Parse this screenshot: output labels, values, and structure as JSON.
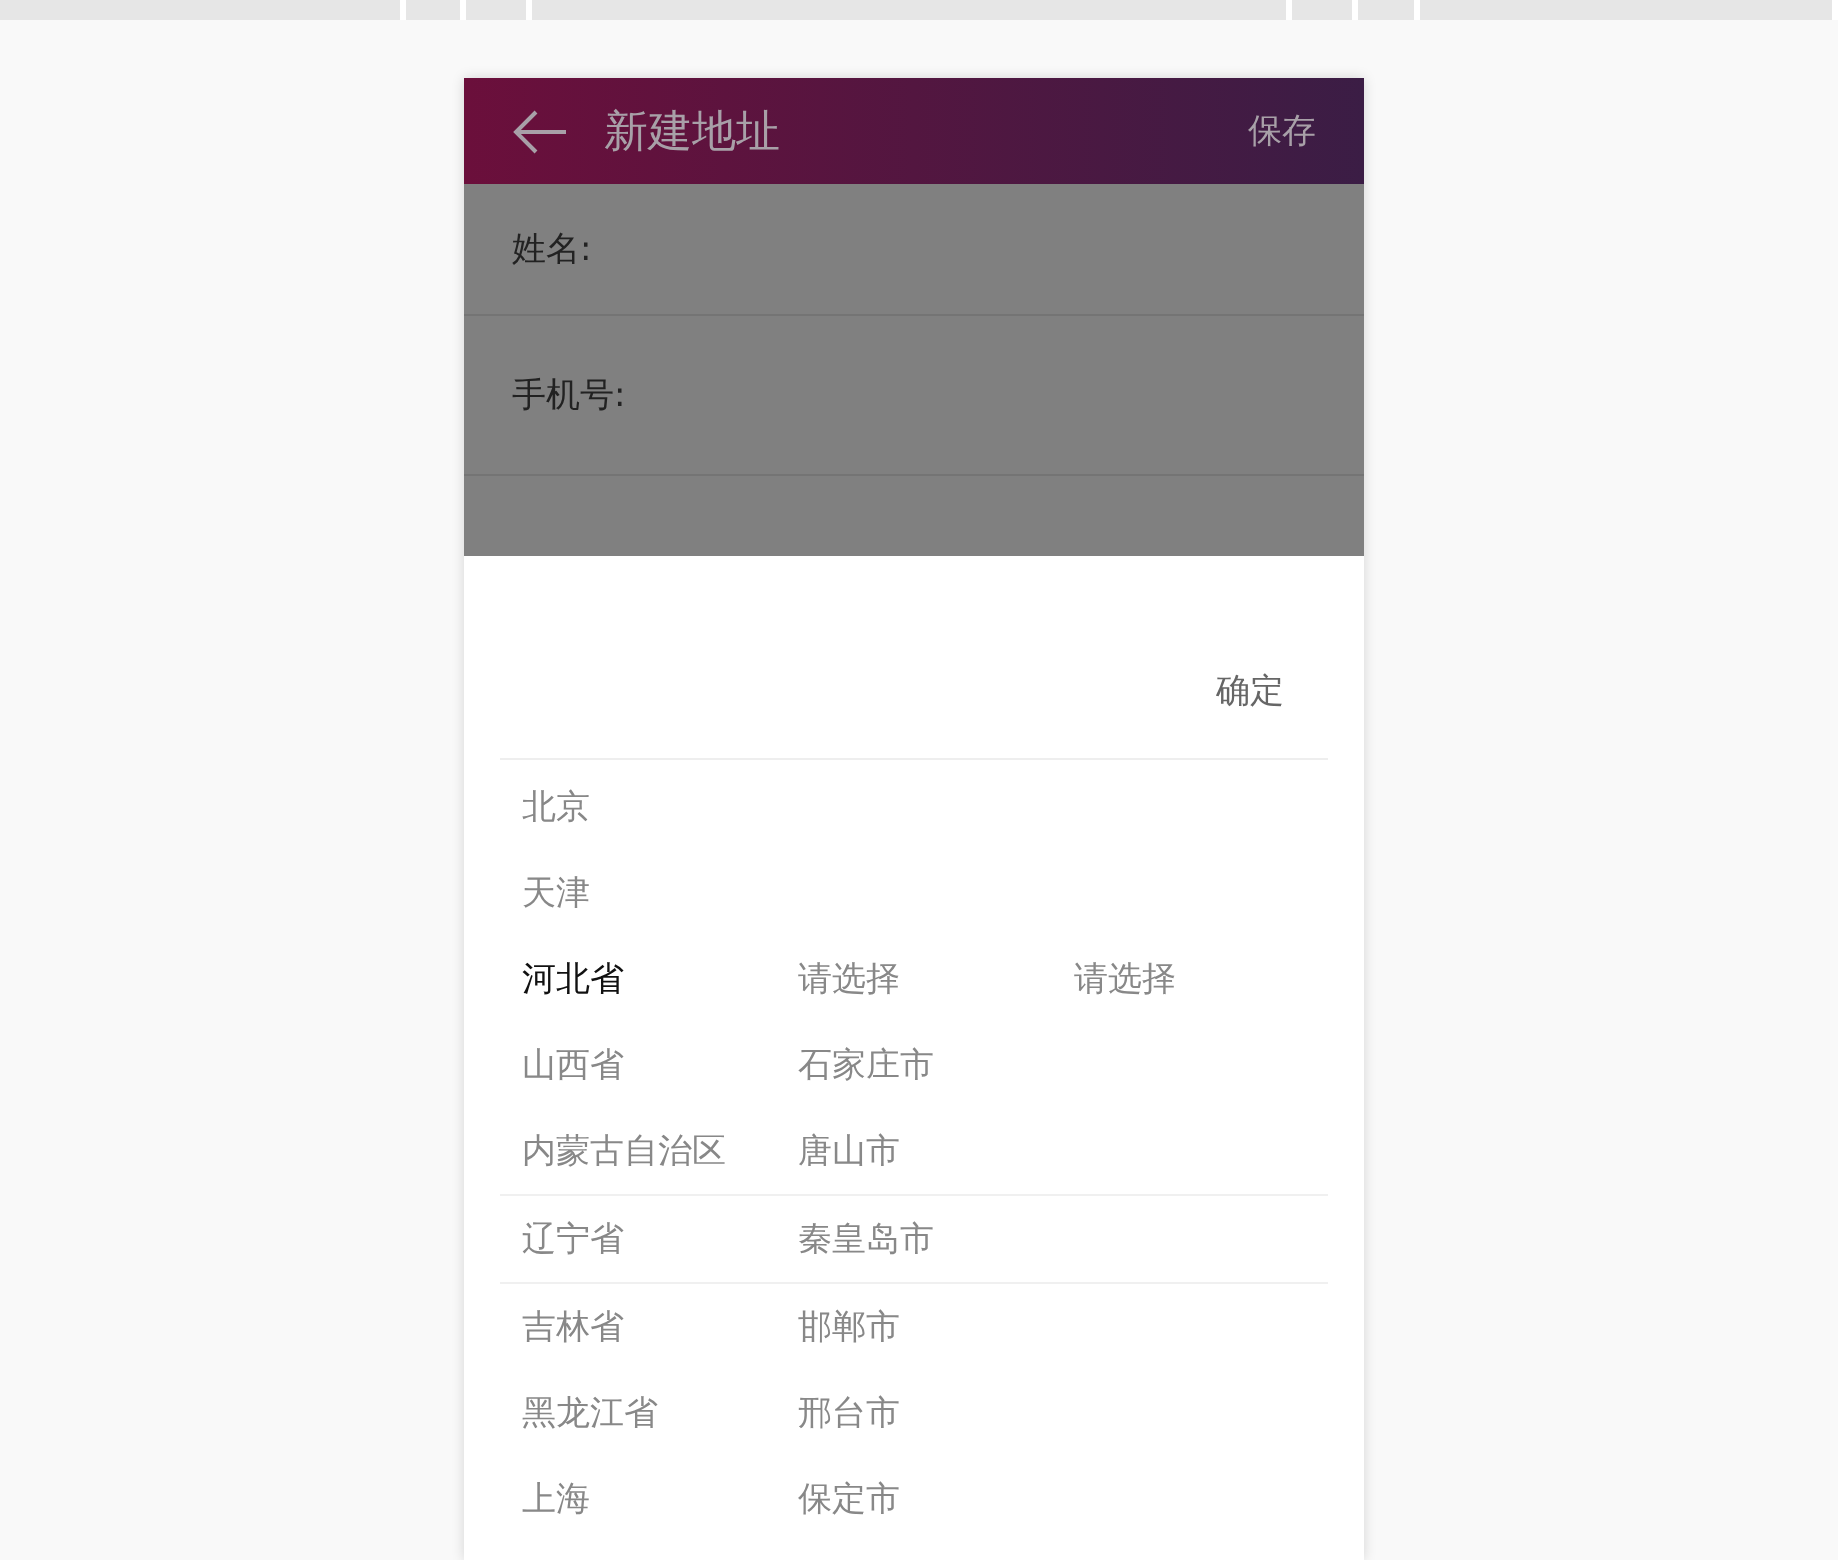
{
  "header": {
    "title": "新建地址",
    "action": "保存"
  },
  "form": {
    "fields": [
      {
        "label": "姓名:"
      },
      {
        "label": "手机号:"
      }
    ]
  },
  "picker": {
    "confirm": "确定",
    "rows": [
      {
        "cells": [
          {
            "text": "北京",
            "selected": false
          }
        ]
      },
      {
        "cells": [
          {
            "text": "天津",
            "selected": false
          }
        ]
      },
      {
        "cells": [
          {
            "text": "河北省",
            "selected": true
          },
          {
            "text": "请选择",
            "selected": false
          },
          {
            "text": "请选择",
            "selected": false
          }
        ]
      },
      {
        "cells": [
          {
            "text": "山西省",
            "selected": false
          },
          {
            "text": "石家庄市",
            "selected": false
          }
        ]
      },
      {
        "cells": [
          {
            "text": "内蒙古自治区",
            "selected": false
          },
          {
            "text": "唐山市",
            "selected": false
          }
        ]
      },
      {
        "cells": [
          {
            "text": "辽宁省",
            "selected": false
          },
          {
            "text": "秦皇岛市",
            "selected": false
          }
        ]
      },
      {
        "cells": [
          {
            "text": "吉林省",
            "selected": false
          },
          {
            "text": "邯郸市",
            "selected": false
          }
        ]
      },
      {
        "cells": [
          {
            "text": "黑龙江省",
            "selected": false
          },
          {
            "text": "邢台市",
            "selected": false
          }
        ]
      },
      {
        "cells": [
          {
            "text": "上海",
            "selected": false
          },
          {
            "text": "保定市",
            "selected": false
          }
        ]
      }
    ]
  }
}
